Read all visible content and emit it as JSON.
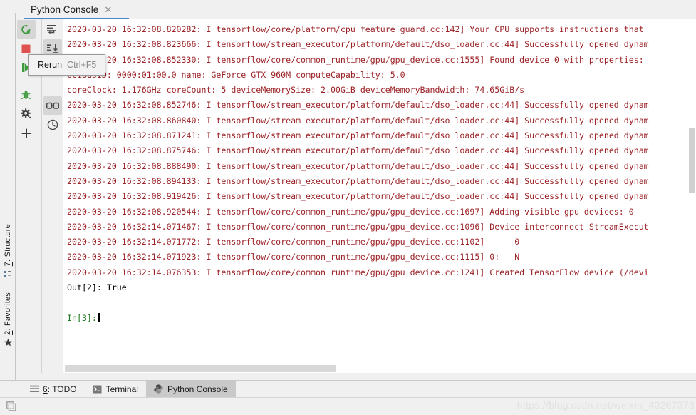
{
  "window": {
    "tab_title": "Python Console",
    "tab_close_icon": "close-icon"
  },
  "tooltip": {
    "label": "Rerun",
    "shortcut": "Ctrl+F5"
  },
  "toolbar_primary": [
    {
      "name": "rerun-button",
      "icon": "rerun-circular-arrow-icon",
      "active": true
    },
    {
      "name": "stop-button",
      "icon": "stop-square-icon",
      "active": false
    },
    {
      "name": "resume-button",
      "icon": "play-triangle-icon",
      "active": false
    },
    {
      "name": "debug-button",
      "icon": "bug-icon",
      "active": false
    },
    {
      "name": "settings-button",
      "icon": "gear-dropdown-icon",
      "active": false
    },
    {
      "name": "add-console-button",
      "icon": "plus-icon",
      "active": false
    }
  ],
  "toolbar_secondary": [
    {
      "name": "execute-current-statement-button",
      "icon": "execute-line-icon",
      "active": false
    },
    {
      "name": "attach-debugger-button",
      "icon": "arrow-down-to-line-icon",
      "active": true
    },
    {
      "name": "show-variables-button",
      "icon": "glasses-icon",
      "active": true
    },
    {
      "name": "command-history-button",
      "icon": "clock-history-icon",
      "active": false
    }
  ],
  "left_rail": [
    {
      "name": "sidebar-item-structure",
      "number": "7",
      "label": ": Structure",
      "icon": "structure-icon"
    },
    {
      "name": "sidebar-item-favorites",
      "number": "2",
      "label": ": Favorites",
      "icon": "star-icon"
    }
  ],
  "console_log": [
    {
      "type": "err",
      "text": "2020-03-20 16:32:08.820282: I tensorflow/core/platform/cpu_feature_guard.cc:142] Your CPU supports instructions that"
    },
    {
      "type": "err",
      "text": "2020-03-20 16:32:08.823666: I tensorflow/stream_executor/platform/default/dso_loader.cc:44] Successfully opened dynam"
    },
    {
      "type": "err",
      "text": "2020-03-20 16:32:08.852330: I tensorflow/core/common_runtime/gpu/gpu_device.cc:1555] Found device 0 with properties:"
    },
    {
      "type": "err",
      "text": "pciBusID: 0000:01:00.0 name: GeForce GTX 960M computeCapability: 5.0"
    },
    {
      "type": "err",
      "text": "coreClock: 1.176GHz coreCount: 5 deviceMemorySize: 2.00GiB deviceMemoryBandwidth: 74.65GiB/s"
    },
    {
      "type": "err",
      "text": "2020-03-20 16:32:08.852746: I tensorflow/stream_executor/platform/default/dso_loader.cc:44] Successfully opened dynam"
    },
    {
      "type": "err",
      "text": "2020-03-20 16:32:08.860840: I tensorflow/stream_executor/platform/default/dso_loader.cc:44] Successfully opened dynam"
    },
    {
      "type": "err",
      "text": "2020-03-20 16:32:08.871241: I tensorflow/stream_executor/platform/default/dso_loader.cc:44] Successfully opened dynam"
    },
    {
      "type": "err",
      "text": "2020-03-20 16:32:08.875746: I tensorflow/stream_executor/platform/default/dso_loader.cc:44] Successfully opened dynam"
    },
    {
      "type": "err",
      "text": "2020-03-20 16:32:08.888490: I tensorflow/stream_executor/platform/default/dso_loader.cc:44] Successfully opened dynam"
    },
    {
      "type": "err",
      "text": "2020-03-20 16:32:08.894133: I tensorflow/stream_executor/platform/default/dso_loader.cc:44] Successfully opened dynam"
    },
    {
      "type": "err",
      "text": "2020-03-20 16:32:08.919426: I tensorflow/stream_executor/platform/default/dso_loader.cc:44] Successfully opened dynam"
    },
    {
      "type": "err",
      "text": "2020-03-20 16:32:08.920544: I tensorflow/core/common_runtime/gpu/gpu_device.cc:1697] Adding visible gpu devices: 0"
    },
    {
      "type": "err",
      "text": "2020-03-20 16:32:14.071467: I tensorflow/core/common_runtime/gpu/gpu_device.cc:1096] Device interconnect StreamExecut"
    },
    {
      "type": "err",
      "text": "2020-03-20 16:32:14.071772: I tensorflow/core/common_runtime/gpu/gpu_device.cc:1102]      0"
    },
    {
      "type": "err",
      "text": "2020-03-20 16:32:14.071923: I tensorflow/core/common_runtime/gpu/gpu_device.cc:1115] 0:   N"
    },
    {
      "type": "err",
      "text": "2020-03-20 16:32:14.076353: I tensorflow/core/common_runtime/gpu/gpu_device.cc:1241] Created TensorFlow device (/devi"
    },
    {
      "type": "out",
      "text": "Out[2]: True"
    },
    {
      "type": "blank",
      "text": " "
    },
    {
      "type": "in",
      "text": "In[3]:",
      "caret": true
    }
  ],
  "bottom_bar": [
    {
      "name": "tool-window-todo",
      "number": "6",
      "label": ": TODO",
      "icon": "list-lines-icon",
      "selected": false
    },
    {
      "name": "tool-window-terminal",
      "number": "",
      "label": "Terminal",
      "icon": "terminal-icon",
      "selected": false
    },
    {
      "name": "tool-window-python-console",
      "number": "",
      "label": "Python Console",
      "icon": "python-icon",
      "selected": true
    }
  ],
  "status_bar": {
    "layout_icon": "window-layout-icon",
    "watermark": "https://blog.csdn.net/weixin_40267373"
  },
  "colors": {
    "log_text": "#a31515",
    "output_text": "#000000",
    "input_prompt": "#1c7a1c",
    "tab_underline": "#4a86c8",
    "panel_bg": "#f0f0f0",
    "console_bg": "#ffffff",
    "selected_tab_bg": "#c9c9c9"
  }
}
